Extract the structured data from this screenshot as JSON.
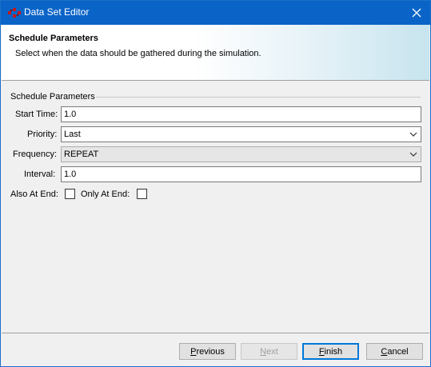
{
  "window": {
    "title": "Data Set Editor"
  },
  "header": {
    "title": "Schedule Parameters",
    "description": "Select when the data should be gathered during the simulation."
  },
  "group": {
    "label": "Schedule Parameters"
  },
  "fields": {
    "start_time": {
      "label": "Start Time:",
      "value": "1.0"
    },
    "priority": {
      "label": "Priority:",
      "value": "Last"
    },
    "frequency": {
      "label": "Frequency:",
      "value": "REPEAT",
      "enabled": false
    },
    "interval": {
      "label": "Interval:",
      "value": "1.0"
    }
  },
  "checks": {
    "also_at_end": {
      "label": "Also At End:",
      "checked": false
    },
    "only_at_end": {
      "label": "Only At End:",
      "checked": false
    }
  },
  "buttons": {
    "previous": {
      "mnemonic": "P",
      "rest": "revious",
      "enabled": true
    },
    "next": {
      "mnemonic": "N",
      "rest": "ext",
      "enabled": false
    },
    "finish": {
      "mnemonic": "F",
      "rest": "inish",
      "enabled": true
    },
    "cancel": {
      "mnemonic": "C",
      "rest": "ancel",
      "enabled": true
    }
  },
  "icons": {
    "app": "app-icon",
    "close": "close-icon",
    "dropdown": "chevron-down-icon"
  }
}
